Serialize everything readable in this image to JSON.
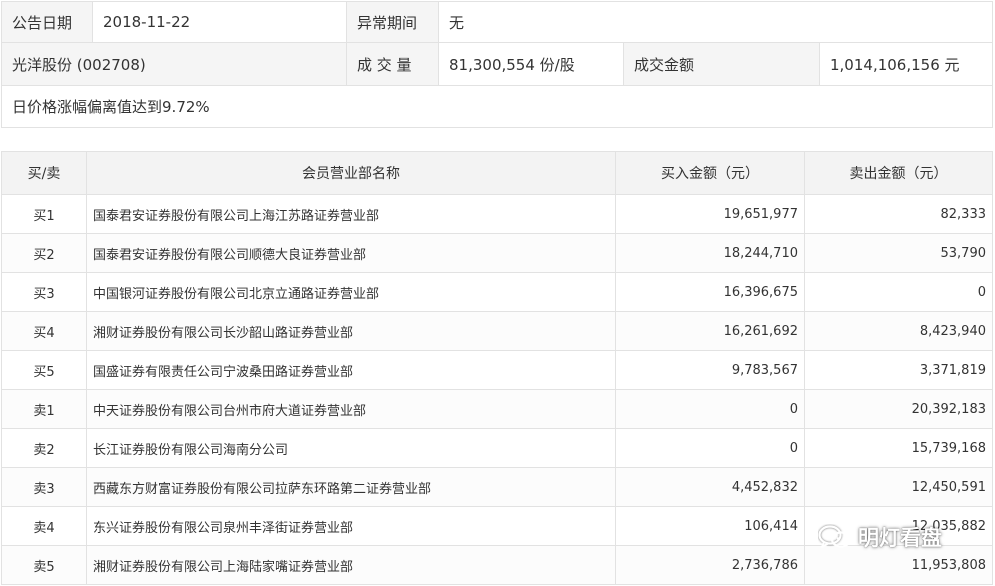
{
  "info": {
    "date_label": "公告日期",
    "date_value": "2018-11-22",
    "abnormal_label": "异常期间",
    "abnormal_value": "无",
    "stock": "光洋股份 (002708)",
    "volume_label": "成 交 量",
    "volume_value": "81,300,554 份/股",
    "amount_label": "成交金额",
    "amount_value": "1,014,106,156 元",
    "reason": "日价格涨幅偏离值达到9.72%"
  },
  "table": {
    "headers": [
      "买/卖",
      "会员营业部名称",
      "买入金额（元）",
      "卖出金额（元）"
    ],
    "rows": [
      {
        "side": "买1",
        "name": "国泰君安证券股份有限公司上海江苏路证券营业部",
        "buy": "19,651,977",
        "sell": "82,333"
      },
      {
        "side": "买2",
        "name": "国泰君安证券股份有限公司顺德大良证券营业部",
        "buy": "18,244,710",
        "sell": "53,790"
      },
      {
        "side": "买3",
        "name": "中国银河证券股份有限公司北京立通路证券营业部",
        "buy": "16,396,675",
        "sell": "0"
      },
      {
        "side": "买4",
        "name": "湘财证券股份有限公司长沙韶山路证券营业部",
        "buy": "16,261,692",
        "sell": "8,423,940"
      },
      {
        "side": "买5",
        "name": "国盛证券有限责任公司宁波桑田路证券营业部",
        "buy": "9,783,567",
        "sell": "3,371,819"
      },
      {
        "side": "卖1",
        "name": "中天证券股份有限公司台州市府大道证券营业部",
        "buy": "0",
        "sell": "20,392,183"
      },
      {
        "side": "卖2",
        "name": "长江证券股份有限公司海南分公司",
        "buy": "0",
        "sell": "15,739,168"
      },
      {
        "side": "卖3",
        "name": "西藏东方财富证券股份有限公司拉萨东环路第二证券营业部",
        "buy": "4,452,832",
        "sell": "12,450,591"
      },
      {
        "side": "卖4",
        "name": "东兴证券股份有限公司泉州丰泽街证券营业部",
        "buy": "106,414",
        "sell": "12,035,882"
      },
      {
        "side": "卖5",
        "name": "湘财证券股份有限公司上海陆家嘴证券营业部",
        "buy": "2,736,786",
        "sell": "11,953,808"
      }
    ]
  },
  "watermark": {
    "text": "明灯看盘",
    "icon": "wechat-icon"
  }
}
